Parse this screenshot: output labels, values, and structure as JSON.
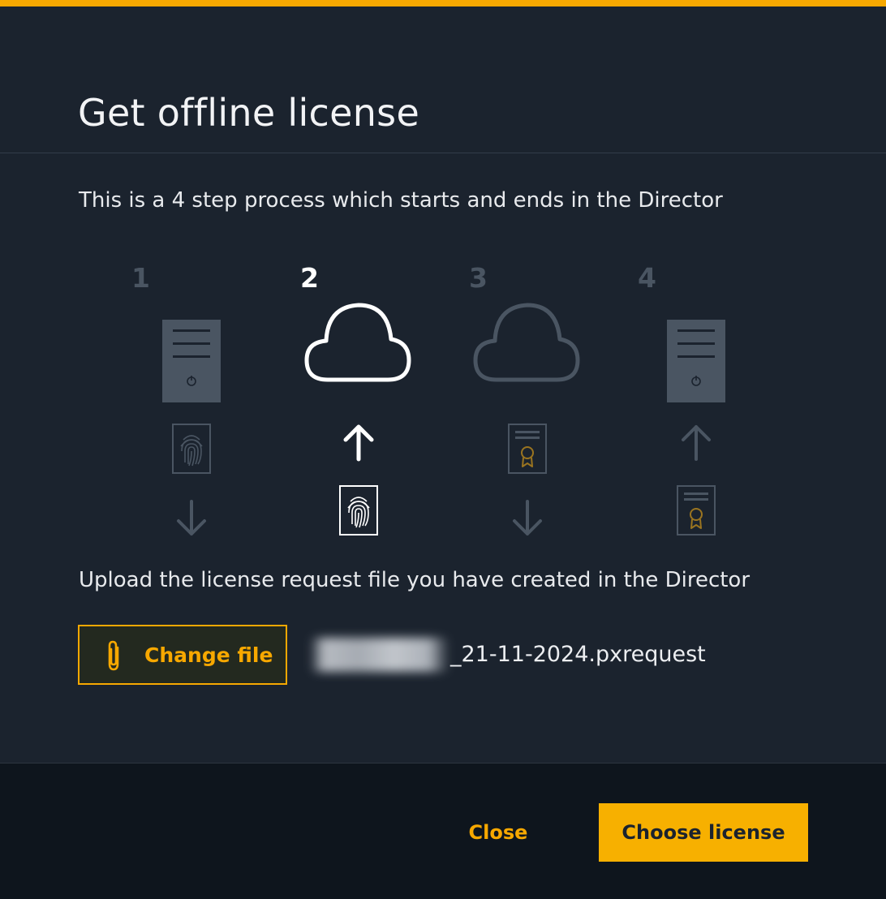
{
  "dialog": {
    "title": "Get offline license",
    "intro": "This is a 4 step process which starts and ends in the Director",
    "steps": [
      {
        "number": "1",
        "icon": "server-icon",
        "active": false
      },
      {
        "number": "2",
        "icon": "cloud-icon",
        "active": true
      },
      {
        "number": "3",
        "icon": "cloud-icon",
        "active": false
      },
      {
        "number": "4",
        "icon": "server-icon",
        "active": false
      }
    ],
    "upload_instruction": "Upload the license request file you have created in the Director",
    "change_file_label": "Change file",
    "file_name_suffix": "_21-11-2024.pxrequest"
  },
  "footer": {
    "close_label": "Close",
    "choose_label": "Choose license"
  },
  "colors": {
    "accent": "#f7a800",
    "background": "#1b232e",
    "footer_background": "#0e151d",
    "inactive_icon": "#4a5562",
    "active_icon": "#ffffff"
  }
}
